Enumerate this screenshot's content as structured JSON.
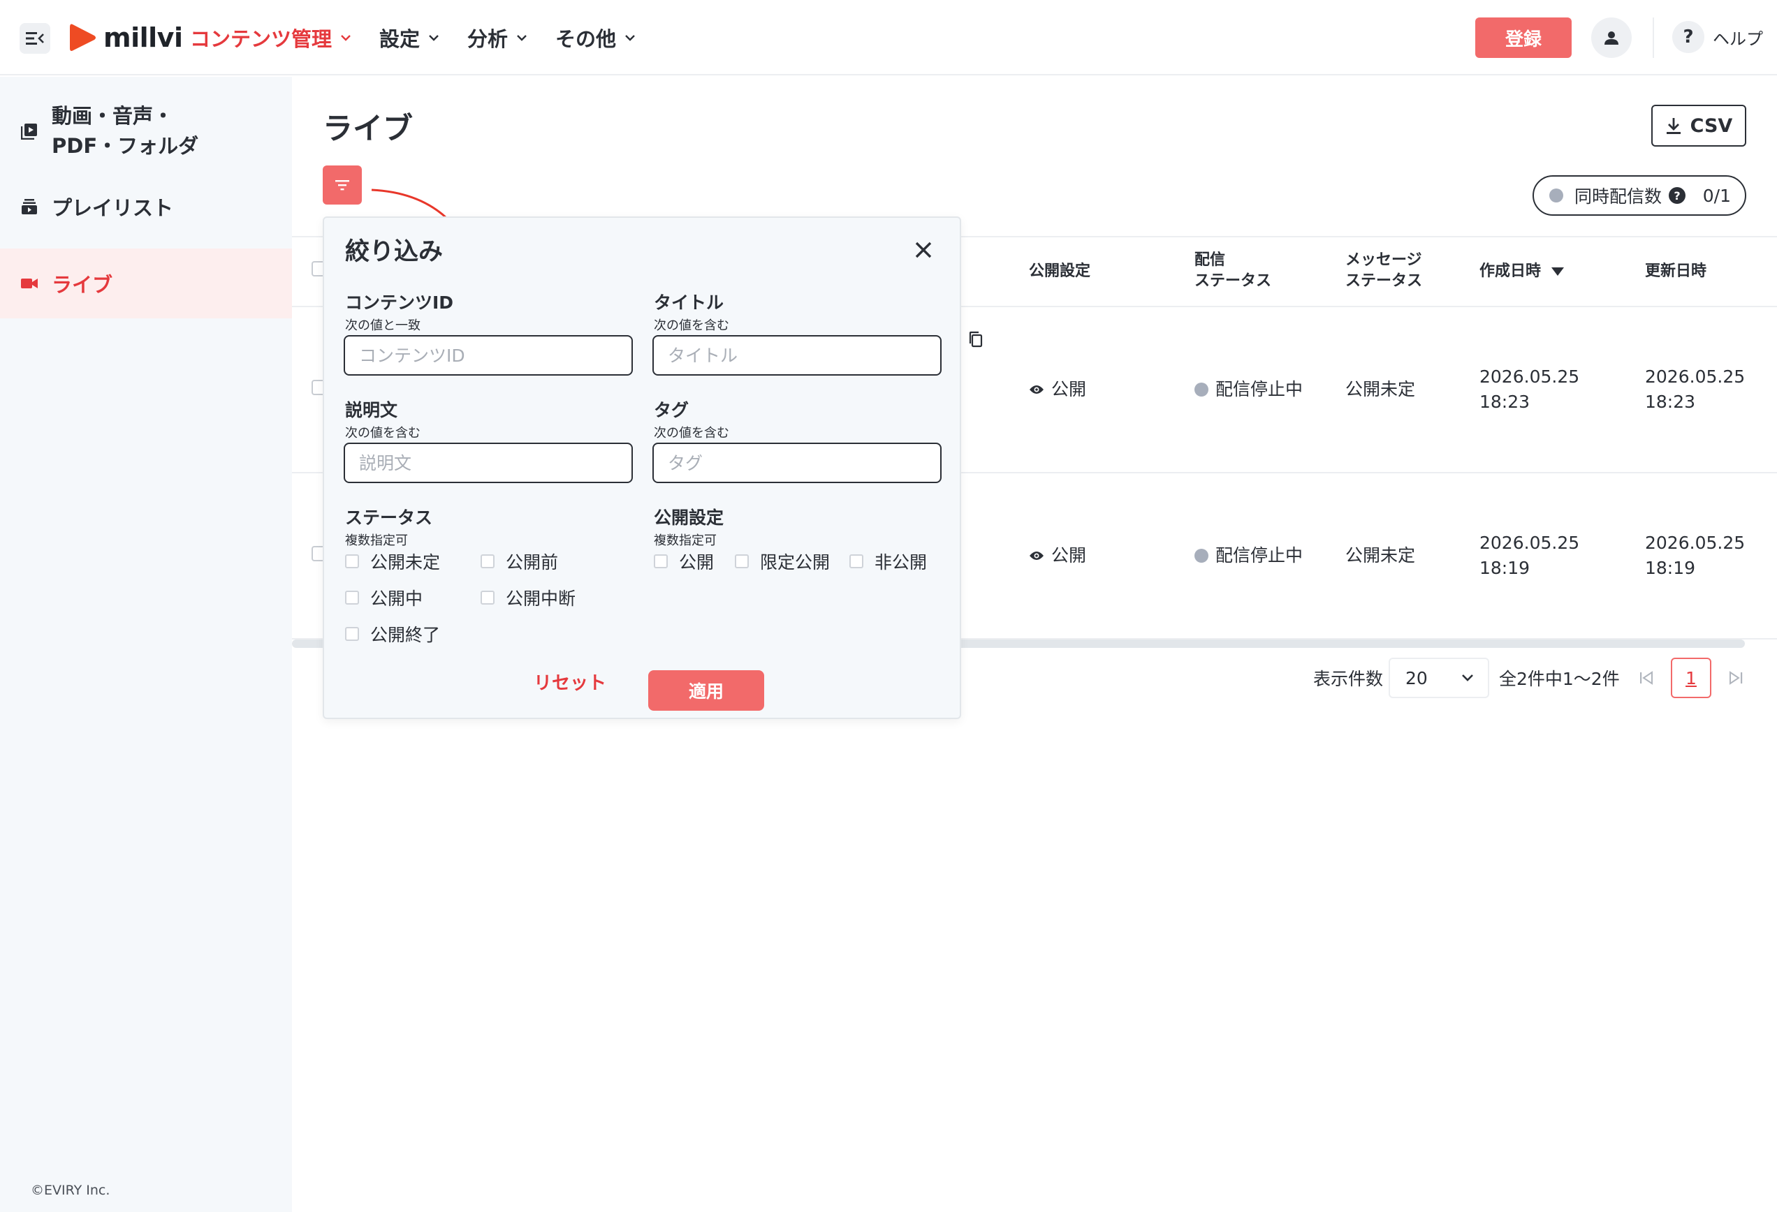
{
  "header": {
    "logo_text": "millvi",
    "nav": [
      {
        "label": "コンテンツ管理",
        "active": true
      },
      {
        "label": "設定",
        "active": false
      },
      {
        "label": "分析",
        "active": false
      },
      {
        "label": "その他",
        "active": false
      }
    ],
    "register_label": "登録",
    "help_label": "ヘルプ",
    "help_mark": "?"
  },
  "sidebar": {
    "items": [
      {
        "label_line1": "動画・音声・",
        "label_line2": "PDF・フォルダ",
        "icon": "video-library-icon"
      },
      {
        "label": "プレイリスト",
        "icon": "playlist-icon"
      },
      {
        "label": "ライブ",
        "icon": "videocam-icon",
        "active": true
      }
    ],
    "copyright": "©EVIRY Inc."
  },
  "main": {
    "title": "ライブ",
    "csv_label": "CSV",
    "concurrent": {
      "label": "同時配信数",
      "value": "0/1"
    }
  },
  "table": {
    "headers": {
      "publish": "公開設定",
      "delivery_line1": "配信",
      "delivery_line2": "ステータス",
      "message_line1": "メッセージ",
      "message_line2": "ステータス",
      "created": "作成日時",
      "updated": "更新日時"
    },
    "rows": [
      {
        "publish": "公開",
        "delivery": "配信停止中",
        "message": "公開未定",
        "created_date": "2026.05.25",
        "created_time": "18:23",
        "updated_date": "2026.05.25",
        "updated_time": "18:23"
      },
      {
        "publish": "公開",
        "delivery": "配信停止中",
        "message": "公開未定",
        "created_date": "2026.05.25",
        "created_time": "18:19",
        "updated_date": "2026.05.25",
        "updated_time": "18:19"
      }
    ]
  },
  "pagination": {
    "per_page_label": "表示件数",
    "per_page_value": "20",
    "summary": "全2件中1〜2件",
    "current_page": "1"
  },
  "filter": {
    "title": "絞り込み",
    "content_id": {
      "label": "コンテンツID",
      "sub": "次の値と一致",
      "placeholder": "コンテンツID"
    },
    "title_field": {
      "label": "タイトル",
      "sub": "次の値を含む",
      "placeholder": "タイトル"
    },
    "description": {
      "label": "説明文",
      "sub": "次の値を含む",
      "placeholder": "説明文"
    },
    "tag": {
      "label": "タグ",
      "sub": "次の値を含む",
      "placeholder": "タグ"
    },
    "status": {
      "label": "ステータス",
      "sub": "複数指定可",
      "options": [
        "公開未定",
        "公開前",
        "公開中",
        "公開中断",
        "公開終了"
      ]
    },
    "publish": {
      "label": "公開設定",
      "sub": "複数指定可",
      "options": [
        "公開",
        "限定公開",
        "非公開"
      ]
    },
    "reset_label": "リセット",
    "apply_label": "適用"
  },
  "colors": {
    "accent": "#e5393d",
    "button": "#f26a6a",
    "sidebar_bg": "#f5f8fb",
    "status_dot": "#a7aebb"
  }
}
